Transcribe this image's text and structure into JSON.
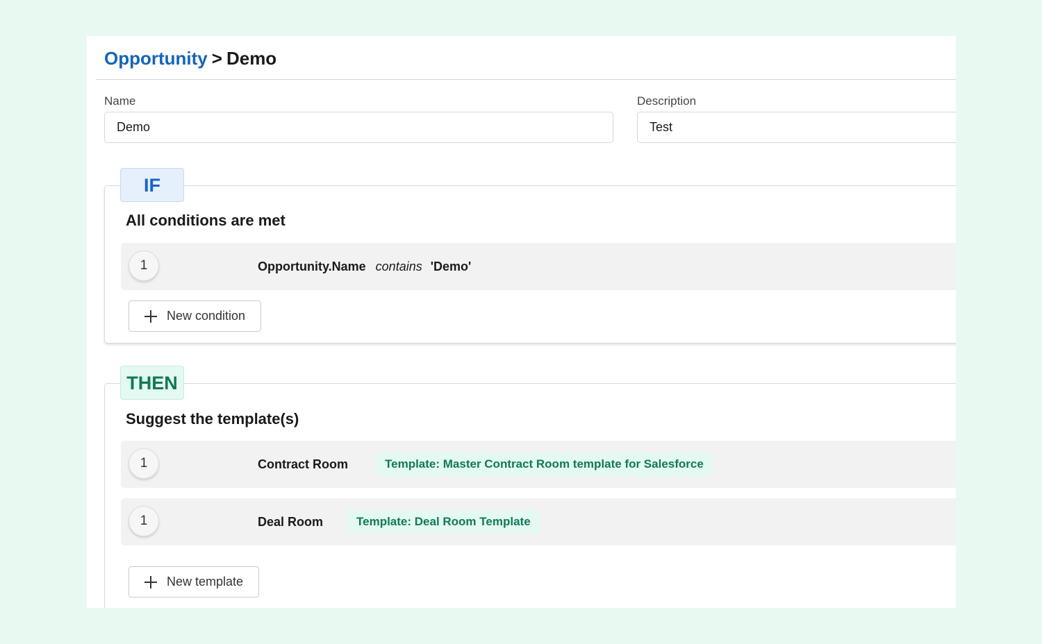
{
  "breadcrumb": {
    "parent": "Opportunity",
    "separator": ">",
    "current": "Demo"
  },
  "form": {
    "name_label": "Name",
    "name_value": "Demo",
    "description_label": "Description",
    "description_value": "Test"
  },
  "if_section": {
    "tag": "IF",
    "title": "All conditions are met",
    "conditions": [
      {
        "number": "1",
        "field": "Opportunity.Name",
        "operator": "contains",
        "value": "'Demo'"
      }
    ],
    "add_button_label": "New condition",
    "add_button_icon": "plus-icon"
  },
  "then_section": {
    "tag": "THEN",
    "title": "Suggest the template(s)",
    "templates": [
      {
        "number": "1",
        "name": "Contract Room",
        "template": "Template: Master Contract Room template for Salesforce"
      },
      {
        "number": "1",
        "name": "Deal Room",
        "template": "Template: Deal Room Template"
      }
    ],
    "add_button_label": "New template",
    "add_button_icon": "plus-icon"
  },
  "colors": {
    "page_background": "#e8f9f1",
    "link_blue": "#1565b8",
    "if_tag_text": "#1b63c6",
    "if_tag_bg": "#e6f0fc",
    "then_tag_text": "#117a56",
    "then_tag_bg": "#e4f9f1",
    "row_bg": "#f2f2f2"
  }
}
